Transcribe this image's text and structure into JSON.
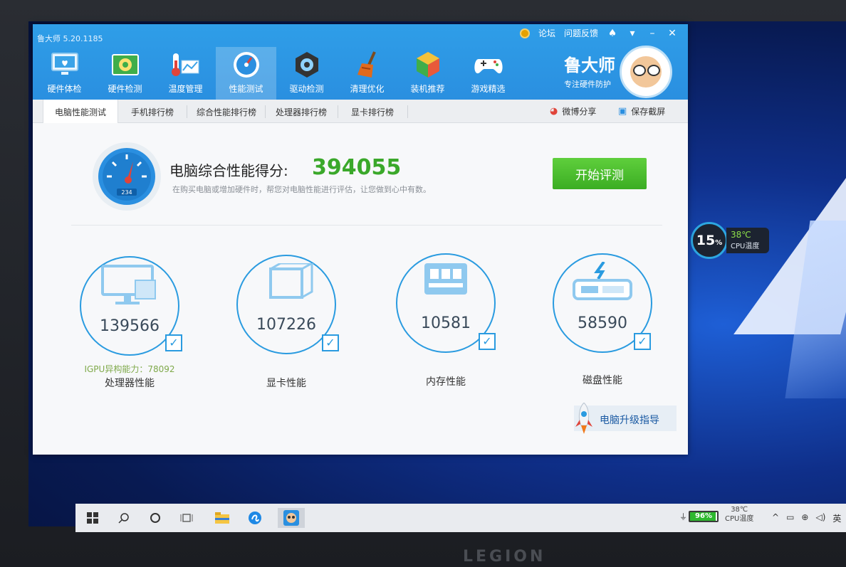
{
  "app": {
    "title": "鲁大师 5.20.1185",
    "top_links": [
      "论坛",
      "问题反馈"
    ],
    "brand_name": "鲁大师",
    "brand_slogan": "专注硬件防护"
  },
  "nav": {
    "items": [
      {
        "label": "硬件体检",
        "icon": "monitor-heart-icon"
      },
      {
        "label": "硬件检测",
        "icon": "circuit-board-icon"
      },
      {
        "label": "温度管理",
        "icon": "thermometer-icon"
      },
      {
        "label": "性能测试",
        "icon": "speed-gauge-icon",
        "active": true
      },
      {
        "label": "驱动检测",
        "icon": "driver-gear-icon"
      },
      {
        "label": "清理优化",
        "icon": "broom-icon"
      },
      {
        "label": "装机推荐",
        "icon": "cube-icon"
      },
      {
        "label": "游戏精选",
        "icon": "gamepad-icon"
      }
    ]
  },
  "subtabs": {
    "items": [
      "电脑性能测试",
      "手机排行榜",
      "综合性能排行榜",
      "处理器排行榜",
      "显卡排行榜"
    ],
    "share": "微博分享",
    "screenshot": "保存截屏"
  },
  "score": {
    "title": "电脑综合性能得分:",
    "value": "394055",
    "description": "在购买电脑或增加硬件时，帮您对电脑性能进行评估，让您做到心中有数。",
    "button": "开始评测",
    "gauge_readout": "234"
  },
  "metrics": [
    {
      "value": "139566",
      "label": "处理器性能",
      "icon": "computer-chip-icon",
      "extra": "IGPU异构能力：78092"
    },
    {
      "value": "107226",
      "label": "显卡性能",
      "icon": "graphics-box-icon"
    },
    {
      "value": "10581",
      "label": "内存性能",
      "icon": "memory-module-icon"
    },
    {
      "value": "58590",
      "label": "磁盘性能",
      "icon": "hard-disk-icon"
    }
  ],
  "upgrade": {
    "label": "电脑升级指导"
  },
  "cpu_widget": {
    "usage": "15",
    "unit": "%",
    "temp": "38℃",
    "label": "CPU温度"
  },
  "taskbar": {
    "battery": "96%",
    "battery_level": 0.96,
    "temp": "38℃",
    "temp_label": "CPU温度",
    "ime": "英"
  },
  "hardware_brand": "LEGION",
  "colors": {
    "accent": "#2a9be0",
    "score_green": "#3aa82a",
    "button_green": "#4cbf2f",
    "titlebar": "#2a8fe0"
  }
}
